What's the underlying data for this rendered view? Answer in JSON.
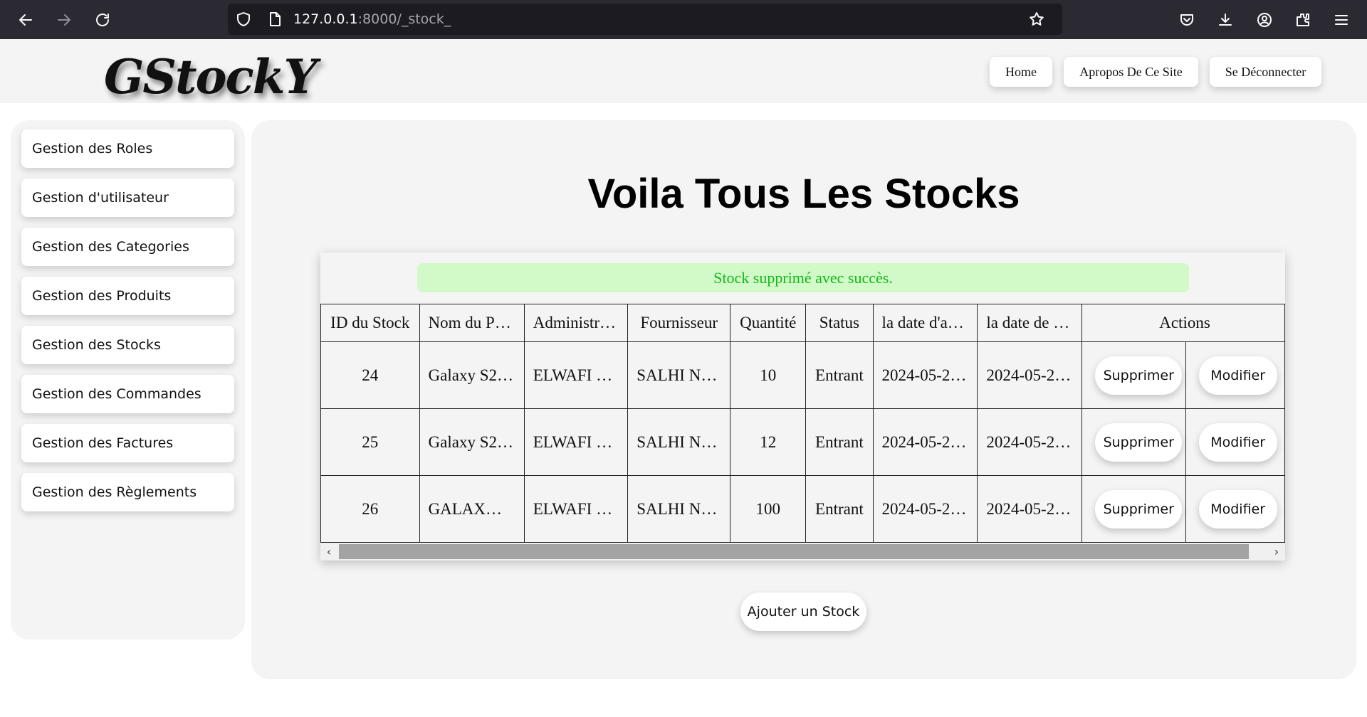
{
  "browser": {
    "url_host": "127.0.0.1",
    "url_path": ":8000/_stock_"
  },
  "header": {
    "logo": "GStockY",
    "nav": [
      "Home",
      "Apropos De Ce Site",
      "Se Déconnecter"
    ]
  },
  "sidebar": {
    "items": [
      "Gestion des Roles",
      "Gestion d'utilisateur",
      "Gestion des Categories",
      "Gestion des Produits",
      "Gestion des Stocks",
      "Gestion des Commandes",
      "Gestion des Factures",
      "Gestion des Règlements"
    ]
  },
  "main": {
    "title": "Voila Tous Les Stocks",
    "alert": "Stock supprimé avec succès.",
    "add_button": "Ajouter un Stock",
    "table": {
      "headers": [
        "ID du Stock",
        "Nom du P…",
        "Administr…",
        "Fournisseur",
        "Quantité",
        "Status",
        "la date d'a…",
        "la date de …",
        "Actions"
      ],
      "rows": [
        {
          "id": "24",
          "produit": "Galaxy S2…",
          "admin": "ELWAFI …",
          "fournisseur": "SALHI N…",
          "quantite": "10",
          "status": "Entrant",
          "date1": "2024-05-2…",
          "date2": "2024-05-2…"
        },
        {
          "id": "25",
          "produit": "Galaxy S2…",
          "admin": "ELWAFI …",
          "fournisseur": "SALHI N…",
          "quantite": "12",
          "status": "Entrant",
          "date1": "2024-05-2…",
          "date2": "2024-05-2…"
        },
        {
          "id": "26",
          "produit": "GALAX…",
          "admin": "ELWAFI …",
          "fournisseur": "SALHI N…",
          "quantite": "100",
          "status": "Entrant",
          "date1": "2024-05-2…",
          "date2": "2024-05-2…"
        }
      ],
      "delete_label": "Supprimer",
      "edit_label": "Modifier"
    }
  }
}
